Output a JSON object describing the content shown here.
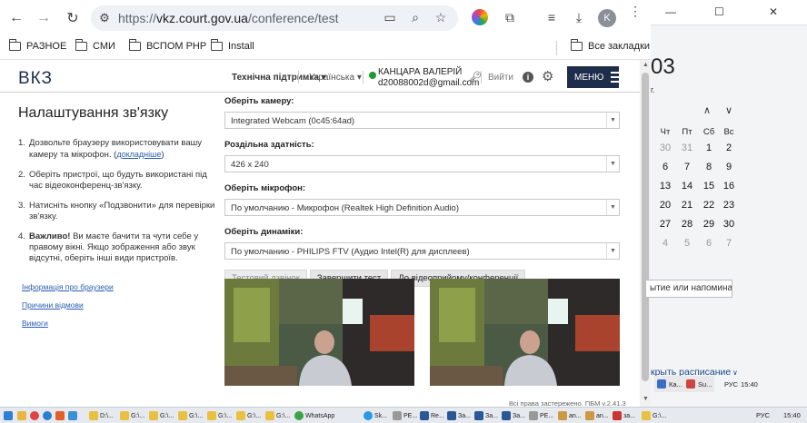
{
  "browser": {
    "url_scheme": "https://",
    "url_host": "vkz.court.gov.ua",
    "url_path": "/conference/test",
    "profile_initial": "K",
    "bookmarks": [
      "РАЗНОЕ",
      "СМИ",
      "ВСПОМ PHP",
      "Install"
    ],
    "all_bookmarks": "Все закладки"
  },
  "site": {
    "logo": "ВКЗ",
    "tech_support": "Технічна підтримка",
    "language": "Українська",
    "user_name": "КАНЦАРА ВАЛЕРІЙ",
    "user_email": "d20088002d@gmail.com",
    "logout": "Вийти",
    "menu_label": "МЕНЮ",
    "info_symbol": "i"
  },
  "left": {
    "title": "Налаштування зв'язку",
    "step1_num": "1.",
    "step1_text": "Дозвольте браузеру використовувати вашу камеру та мікрофон. (",
    "step1_link": "докладніше",
    "step1_end": ")",
    "step2_num": "2.",
    "step2_text": "Оберіть пристрої, що будуть використані під час відеоконференц-зв'язку.",
    "step3_num": "3.",
    "step3_text": "Натисніть кнопку «Подзвонити» для перевірки зв'язку.",
    "step4_num": "4.",
    "step4_bold": "Важливо!",
    "step4_text": " Ви маєте бачити та чути себе у правому вікні. Якщо зображення або звук відсутні, оберіть інші види пристроїв.",
    "links": [
      "Інформація про браузери",
      "Причини відмови",
      "Вимоги"
    ]
  },
  "form": {
    "camera_label": "Оберіть камеру:",
    "camera_value": "Integrated Webcam (0c45:64ad)",
    "resolution_label": "Роздільна здатність:",
    "resolution_value": "426 x 240",
    "mic_label": "Оберіть мікрофон:",
    "mic_value": "По умолчанию - Микрофон (Realtek High Definition Audio)",
    "speaker_label": "Оберіть динаміки:",
    "speaker_value": "По умолчанию - PHILIPS FTV (Аудио Intel(R) для дисплеев)",
    "btn_test_call": "Тестовий дзвінок",
    "btn_end_test": "Завершити тест",
    "btn_to_conf": "До відеоприйому/конференції"
  },
  "footer": {
    "copyright": "Всі права застережено. ПБМ v.2.41.3"
  },
  "calendar": {
    "big_date_fragment": "03",
    "sub_fragment": "г.",
    "weekdays": [
      "Чт",
      "Пт",
      "Сб",
      "Вс"
    ],
    "rows": [
      [
        "30",
        "31",
        "1",
        "2"
      ],
      [
        "6",
        "7",
        "8",
        "9"
      ],
      [
        "13",
        "14",
        "15",
        "16"
      ],
      [
        "20",
        "21",
        "22",
        "23"
      ],
      [
        "27",
        "28",
        "29",
        "30"
      ],
      [
        "4",
        "5",
        "6",
        "7"
      ]
    ],
    "note_placeholder": "ытие или напоминан",
    "schedule_link": "крыть расписание",
    "mini_clock": "15:40",
    "mini_lang": "РУС"
  },
  "taskbar": {
    "items": [
      "D:\\...",
      "G:\\...",
      "G:\\...",
      "G:\\...",
      "G:\\...",
      "G:\\...",
      "G:\\...",
      "WhatsApp",
      "Sk...",
      "PE...",
      "Re...",
      "За...",
      "За...",
      "За...",
      "PE...",
      "an...",
      "an...",
      "за...",
      "G:\\..."
    ],
    "lang": "РУС",
    "clock": "15:40"
  }
}
